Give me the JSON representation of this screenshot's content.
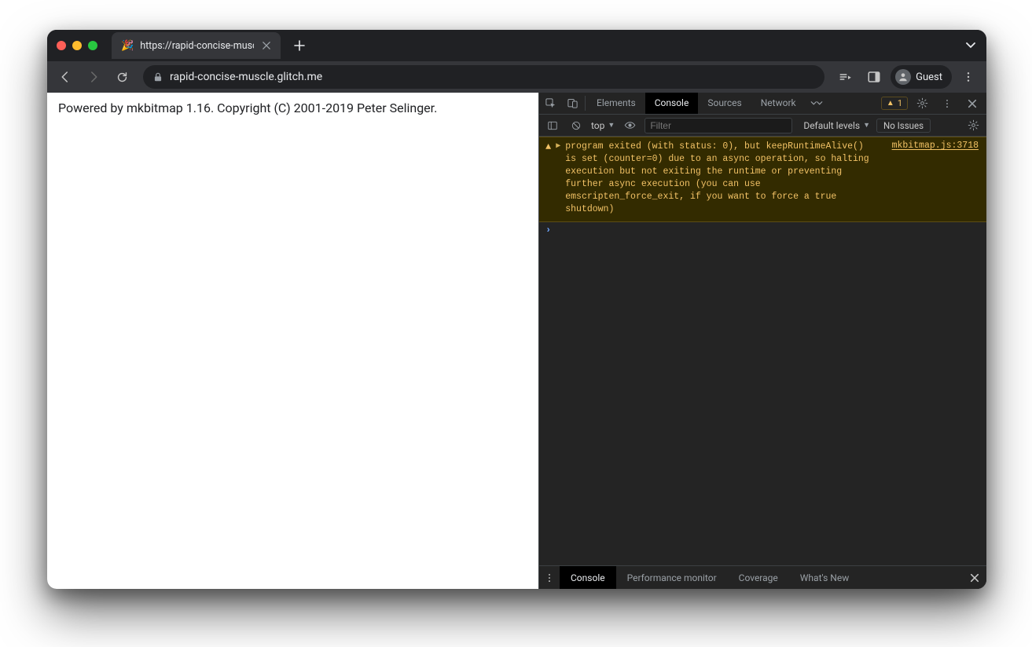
{
  "browser": {
    "tab_title": "https://rapid-concise-muscle.g",
    "url": "rapid-concise-muscle.glitch.me",
    "profile_label": "Guest"
  },
  "page": {
    "content": "Powered by mkbitmap 1.16. Copyright (C) 2001-2019 Peter Selinger."
  },
  "devtools": {
    "tabs": [
      "Elements",
      "Console",
      "Sources",
      "Network"
    ],
    "active_tab": "Console",
    "warning_count": "1",
    "console_toolbar": {
      "context": "top",
      "filter_placeholder": "Filter",
      "levels_label": "Default levels",
      "issues_label": "No Issues"
    },
    "messages": [
      {
        "type": "warning",
        "text": "program exited (with status: 0), but keepRuntimeAlive() is set (counter=0) due to an async operation, so halting execution but not exiting the runtime or preventing further async execution (you can use emscripten_force_exit, if you want to force a true shutdown)",
        "source": "mkbitmap.js:3718"
      }
    ],
    "drawer_tabs": [
      "Console",
      "Performance monitor",
      "Coverage",
      "What's New"
    ],
    "drawer_active": "Console"
  }
}
